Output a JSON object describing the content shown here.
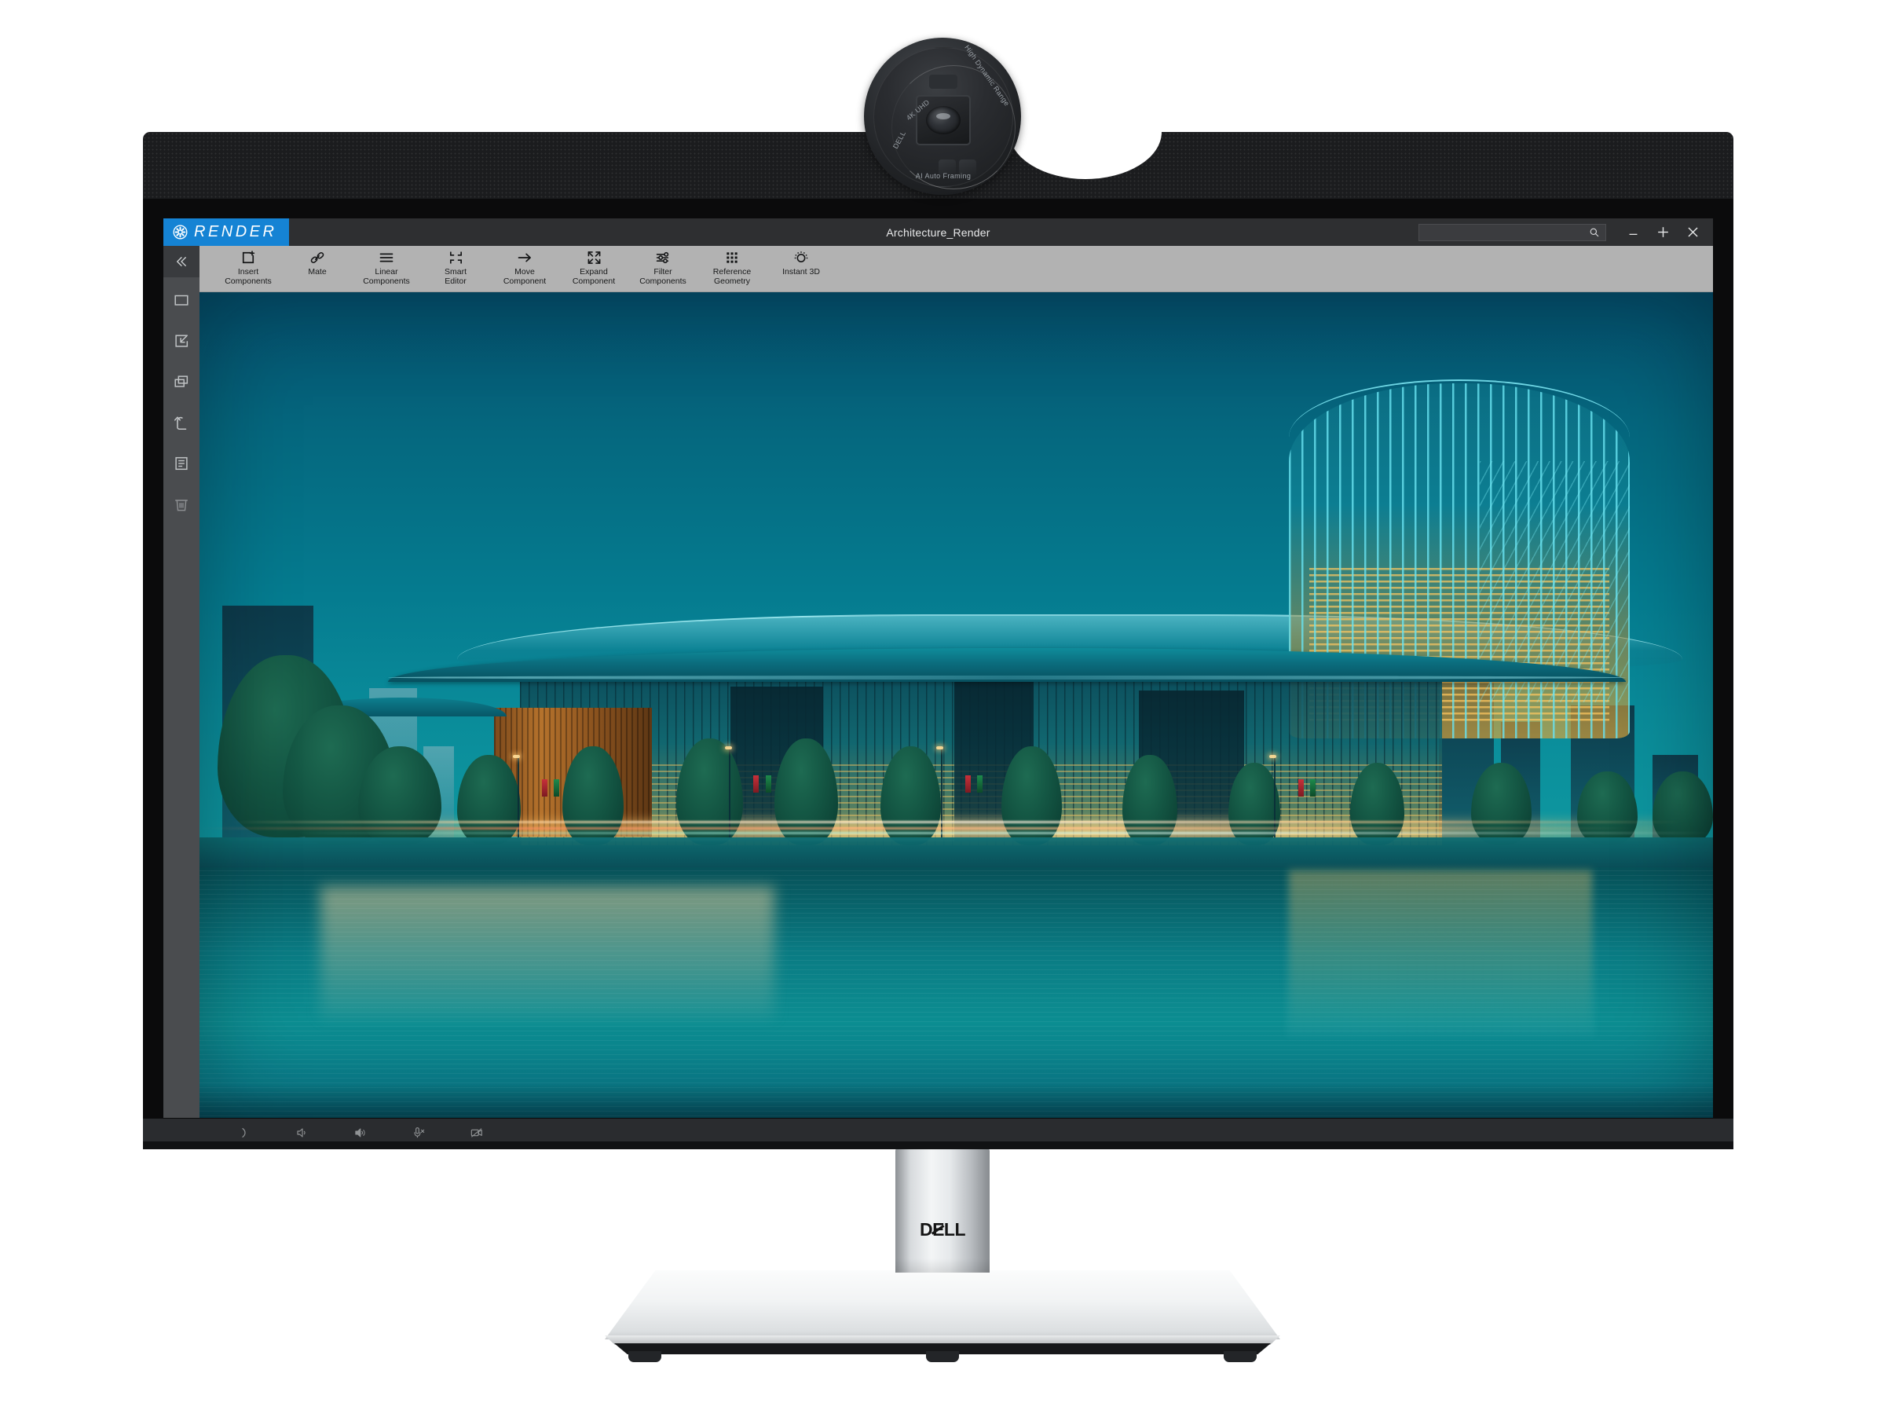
{
  "hardware": {
    "brand": "DELL",
    "webcam": {
      "label_left": "DELL",
      "label_res": "4K UHD",
      "label_right": "High Dynamic Range",
      "label_bottom": "AI Auto Framing"
    },
    "osd_buttons": [
      {
        "name": "joystick-button",
        "glyph": ")"
      },
      {
        "name": "volume-down-button",
        "glyph": "volume-low-icon"
      },
      {
        "name": "volume-up-button",
        "glyph": "volume-high-icon"
      },
      {
        "name": "mic-mute-button",
        "glyph": "mic-off-icon"
      },
      {
        "name": "camera-off-button",
        "glyph": "camera-off-icon"
      }
    ]
  },
  "app": {
    "brand_name": "RENDER",
    "brand_color": "#1583d4",
    "document_title": "Architecture_Render",
    "search": {
      "value": "",
      "placeholder": ""
    },
    "window_controls": [
      {
        "name": "minimize-button",
        "label": "—"
      },
      {
        "name": "maximize-button",
        "label": "+"
      },
      {
        "name": "close-button",
        "label": "✕"
      }
    ],
    "sidebar": {
      "collapse_label": "«",
      "items": [
        {
          "name": "sidebar-item-new-sketch",
          "icon": "rectangle-icon"
        },
        {
          "name": "sidebar-item-import",
          "icon": "import-arrow-icon"
        },
        {
          "name": "sidebar-item-duplicate",
          "icon": "copy-layers-icon"
        },
        {
          "name": "sidebar-item-undo",
          "icon": "undo-arrow-icon"
        },
        {
          "name": "sidebar-item-properties",
          "icon": "document-list-icon"
        },
        {
          "name": "sidebar-item-delete",
          "icon": "trash-icon"
        }
      ]
    },
    "ribbon": {
      "items": [
        {
          "name": "ribbon-insert-components",
          "icon": "square-plus-icon",
          "label": "Insert\nComponents"
        },
        {
          "name": "ribbon-mate",
          "icon": "chain-link-icon",
          "label": "Mate"
        },
        {
          "name": "ribbon-linear-components",
          "icon": "hamburger-lines-icon",
          "label": "Linear\nComponents"
        },
        {
          "name": "ribbon-smart-editor",
          "icon": "corner-brackets-icon",
          "label": "Smart\nEditor"
        },
        {
          "name": "ribbon-move-component",
          "icon": "arrow-right-icon",
          "label": "Move\nComponent"
        },
        {
          "name": "ribbon-expand-component",
          "icon": "expand-diagonal-icon",
          "label": "Expand\nComponent"
        },
        {
          "name": "ribbon-filter-components",
          "icon": "sliders-icon",
          "label": "Filter\nComponents"
        },
        {
          "name": "ribbon-reference-geometry",
          "icon": "grid-dots-icon",
          "label": "Reference\nGeometry"
        },
        {
          "name": "ribbon-instant-3d",
          "icon": "sun-circle-icon",
          "label": "Instant 3D"
        }
      ]
    },
    "canvas": {
      "scene_name": "Architecture_Render",
      "palette": {
        "sky_top": "#044f6c",
        "sky_bottom": "#0e97a0",
        "water": "#0a7a82",
        "glass_teal": "#12788c",
        "interior_glow": "#e2a83a",
        "fin_highlight": "#68e2f0",
        "wood_facade": "#b5722c"
      }
    }
  }
}
